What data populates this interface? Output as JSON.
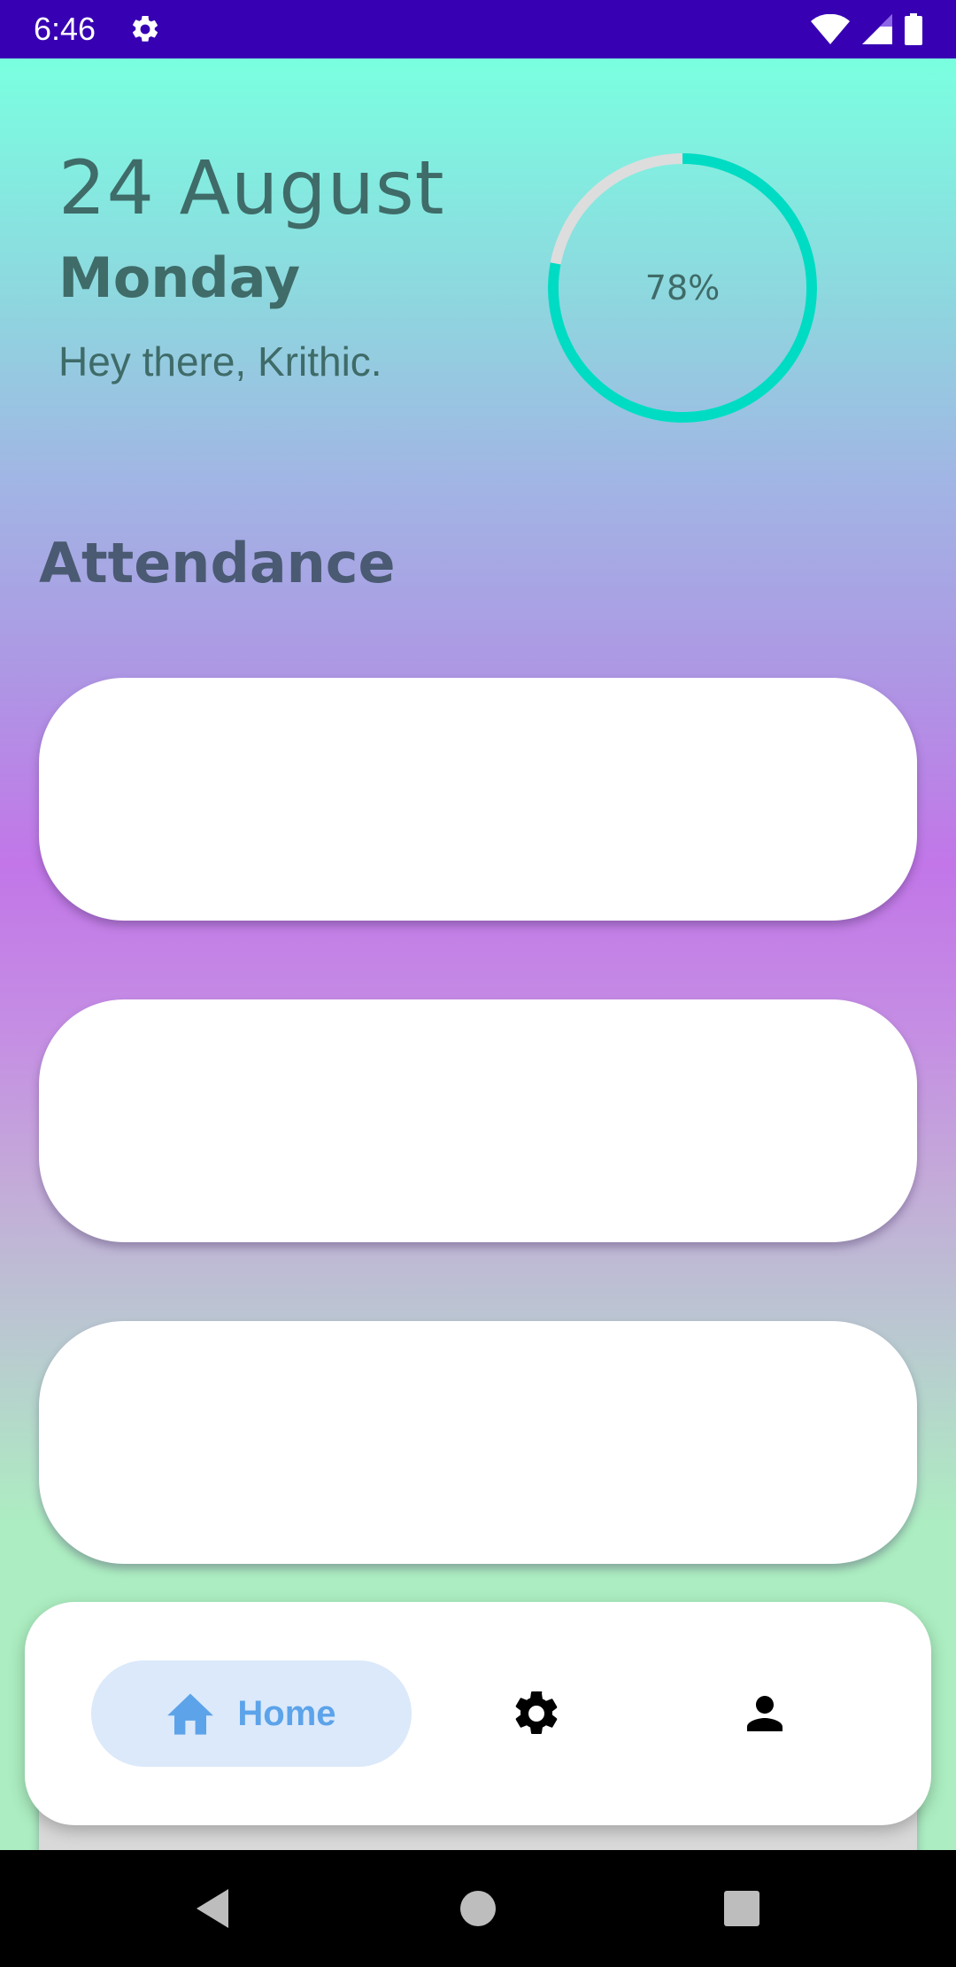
{
  "status_bar": {
    "time": "6:46",
    "background": "#3700b3",
    "icons": [
      "settings-gear-icon",
      "wifi-icon",
      "cellular-signal-icon",
      "battery-icon"
    ]
  },
  "header": {
    "date": "24 August",
    "weekday": "Monday",
    "greeting": "Hey there, Krithic."
  },
  "attendance_progress": {
    "label": "78%",
    "value": 0.78,
    "ring_color": "#00dcc4",
    "track_color": "#dddddd"
  },
  "attendance": {
    "title": "Attendance",
    "cards": [
      {
        "label": ""
      },
      {
        "label": ""
      },
      {
        "label": ""
      }
    ]
  },
  "bottom_nav": {
    "items": [
      {
        "label": "Home",
        "icon": "home-icon",
        "active": true
      },
      {
        "label": "",
        "icon": "settings-icon",
        "active": false
      },
      {
        "label": "",
        "icon": "profile-icon",
        "active": false
      }
    ],
    "active_color": "#5ca3ea",
    "active_pill": "#dbe9fa"
  },
  "system_nav": {
    "buttons": [
      "back-icon",
      "home-circle-icon",
      "recents-icon"
    ]
  }
}
